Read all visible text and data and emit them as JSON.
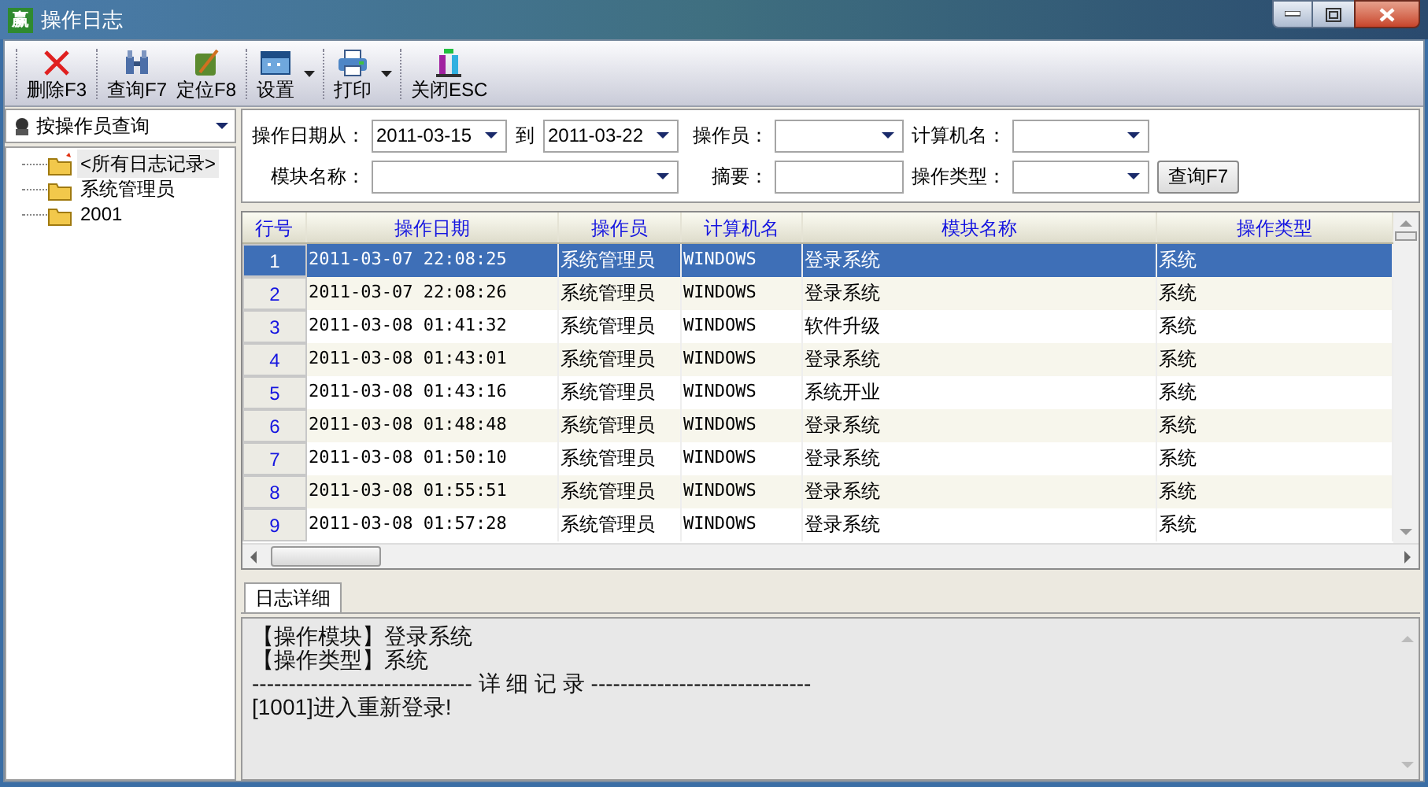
{
  "window": {
    "title": "操作日志",
    "logo_text": "赢"
  },
  "toolbar": [
    {
      "kind": "delete",
      "label": "删除F3",
      "dropdown": false
    },
    {
      "kind": "query",
      "label": "查询F7",
      "dropdown": false
    },
    {
      "kind": "locate",
      "label": "定位F8",
      "dropdown": false
    },
    {
      "kind": "settings",
      "label": "设置",
      "dropdown": true
    },
    {
      "kind": "print",
      "label": "打印",
      "dropdown": true
    },
    {
      "kind": "close",
      "label": "关闭ESC",
      "dropdown": false
    }
  ],
  "sidebar": {
    "mode": "按操作员查询",
    "tree": [
      {
        "label": "<所有日志记录>",
        "selected": true,
        "kind": "root"
      },
      {
        "label": "系统管理员",
        "selected": false,
        "kind": "folder"
      },
      {
        "label": "2001",
        "selected": false,
        "kind": "folder"
      }
    ]
  },
  "filters": [
    [
      {
        "kind": "label",
        "text": "操作日期从："
      },
      {
        "kind": "combo",
        "value": "2011-03-15"
      },
      {
        "kind": "sep",
        "text": "到"
      },
      {
        "kind": "combo",
        "value": "2011-03-22"
      },
      {
        "kind": "label",
        "text": "操作员："
      },
      {
        "kind": "combo"
      },
      {
        "kind": "label",
        "text": "计算机名："
      },
      {
        "kind": "combo"
      }
    ],
    [
      {
        "kind": "label",
        "text": "模块名称："
      },
      {
        "kind": "combo"
      },
      {
        "kind": "label",
        "text": "摘要："
      },
      {
        "kind": "text"
      },
      {
        "kind": "label",
        "text": "操作类型："
      },
      {
        "kind": "combo"
      },
      {
        "kind": "button",
        "text": "查询F7"
      }
    ]
  ],
  "table": {
    "columns": [
      "行号",
      "操作日期",
      "操作员",
      "计算机名",
      "模块名称",
      "操作类型"
    ],
    "rows": [
      {
        "selected": true,
        "cells": [
          "1",
          "2011-03-07 22:08:25",
          "系统管理员",
          "WINDOWS",
          "登录系统",
          "系统"
        ]
      },
      {
        "selected": false,
        "cells": [
          "2",
          "2011-03-07 22:08:26",
          "系统管理员",
          "WINDOWS",
          "登录系统",
          "系统"
        ]
      },
      {
        "selected": false,
        "cells": [
          "3",
          "2011-03-08 01:41:32",
          "系统管理员",
          "WINDOWS",
          "软件升级",
          "系统"
        ]
      },
      {
        "selected": false,
        "cells": [
          "4",
          "2011-03-08 01:43:01",
          "系统管理员",
          "WINDOWS",
          "登录系统",
          "系统"
        ]
      },
      {
        "selected": false,
        "cells": [
          "5",
          "2011-03-08 01:43:16",
          "系统管理员",
          "WINDOWS",
          "系统开业",
          "系统"
        ]
      },
      {
        "selected": false,
        "cells": [
          "6",
          "2011-03-08 01:48:48",
          "系统管理员",
          "WINDOWS",
          "登录系统",
          "系统"
        ]
      },
      {
        "selected": false,
        "cells": [
          "7",
          "2011-03-08 01:50:10",
          "系统管理员",
          "WINDOWS",
          "登录系统",
          "系统"
        ]
      },
      {
        "selected": false,
        "cells": [
          "8",
          "2011-03-08 01:55:51",
          "系统管理员",
          "WINDOWS",
          "登录系统",
          "系统"
        ]
      },
      {
        "selected": false,
        "cells": [
          "9",
          "2011-03-08 01:57:28",
          "系统管理员",
          "WINDOWS",
          "登录系统",
          "系统"
        ]
      }
    ]
  },
  "detail": {
    "tabs": [
      {
        "label": "日志详细",
        "selected": true
      }
    ],
    "lines": [
      "【操作模块】登录系统",
      "【操作类型】系统",
      "------------------------------ 详 细 记 录 ------------------------------",
      "[1001]进入重新登录!"
    ]
  }
}
